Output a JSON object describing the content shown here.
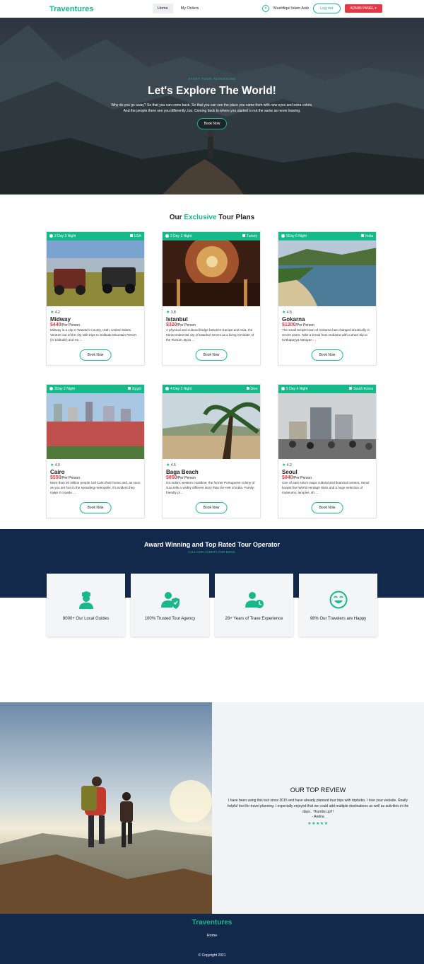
{
  "navbar": {
    "brand": "Traventures",
    "links": [
      "Home",
      "My Orders"
    ],
    "user_name": "Mushfiqul Islam Anik",
    "logout_label": "Log out",
    "admin_label": "ADMIN PANEL"
  },
  "hero": {
    "tagline": "START YOUR ADVENTURE",
    "title": "Let's Explore The World!",
    "text": "Why do you go away? So that you can come back. So that you can see the place you came from with new eyes and extra colors. And the people there see you differently, too. Coming back to where you started is not the same as never leaving.",
    "button": "Book Now"
  },
  "tours": {
    "title_prefix": "Our",
    "title_accent": "Exclusive",
    "title_suffix": "Tour Plans",
    "button": "Book Now",
    "per_person": "/Per Person",
    "items": [
      {
        "duration": "2 Day 3 Night",
        "country": "USA",
        "rating": "4.2",
        "name": "Midway",
        "price": "$440",
        "desc": "Midway is a city in Wasatch County, Utah, United States. Venture out of the city with trips to Solitude Mountain Resort (in Solitude) and Su ..."
      },
      {
        "duration": "2 Day 1 Night",
        "country": "Turkey",
        "rating": "3.8",
        "name": "Istanbul",
        "price": "$320",
        "desc": "A physical and cultural bridge between Europe and Asia, the transcontinental city of Istanbul serves as a living reminder of the Roman, Byza ..."
      },
      {
        "duration": "5Day 6 Night",
        "country": "India",
        "rating": "4.5",
        "name": "Gokarna",
        "price": "$1200",
        "desc": "The small temple town of Gokarna has changed drastically in recent years. Take a break from Gokarna with a short trip to Kethapayya Narayan ..."
      },
      {
        "duration": "3Day 2 Night",
        "country": "Egypt",
        "rating": "4.0",
        "name": "Cairo",
        "price": "$550",
        "desc": "More than 20 million people call Cairo their home and, as soon as you set foot in the sprawling metropolis, it's evident they make it crowde ..."
      },
      {
        "duration": "4 Day 3 Night",
        "country": "Goa",
        "rating": "4.5",
        "name": "Baga Beach",
        "price": "$850",
        "desc": "On India's western coastline, the former Portuguese colony of Goa tells a visibly different story than the rest of India. Family-friendly pl ..."
      },
      {
        "duration": "5 Day 4 Night",
        "country": "South Korea",
        "rating": "4.2",
        "name": "Seoul",
        "price": "$840",
        "desc": "One of east Asia's major cultural and financial centers, Seoul boasts five World Heritage Sites and a huge selection of museums, temples, sh ..."
      }
    ]
  },
  "award": {
    "title": "Award Winning and Top Rated Tour Operator",
    "subtitle": "CALL OUR AGENTS FOR BOOK.",
    "items": [
      {
        "icon": "guide-icon",
        "label": "8000+ Our Local Guides"
      },
      {
        "icon": "trusted-shield-icon",
        "label": "100% Trusted Tour Agency"
      },
      {
        "icon": "experience-clock-icon",
        "label": "28+ Years of Trave Experience"
      },
      {
        "icon": "happy-face-icon",
        "label": "98% Our Travelers are Happy"
      }
    ]
  },
  "review": {
    "title": "OUR TOP REVIEW",
    "text": "I have been using this tool since 2015 and have already planned tour trips with triphobo. I love your website. Really helpful tool for travel planning. I especially enjoyed that we could add multiple destinations as well as activities in the days.. Thumbs up!!!",
    "author": "- Andria",
    "stars": "★★★★★"
  },
  "footer": {
    "brand": "Traventures",
    "home": "Home",
    "copyright": "© Copyright 2021"
  },
  "colors": {
    "accent": "#17b88a",
    "navy": "#13294b",
    "price": "#e63946"
  }
}
